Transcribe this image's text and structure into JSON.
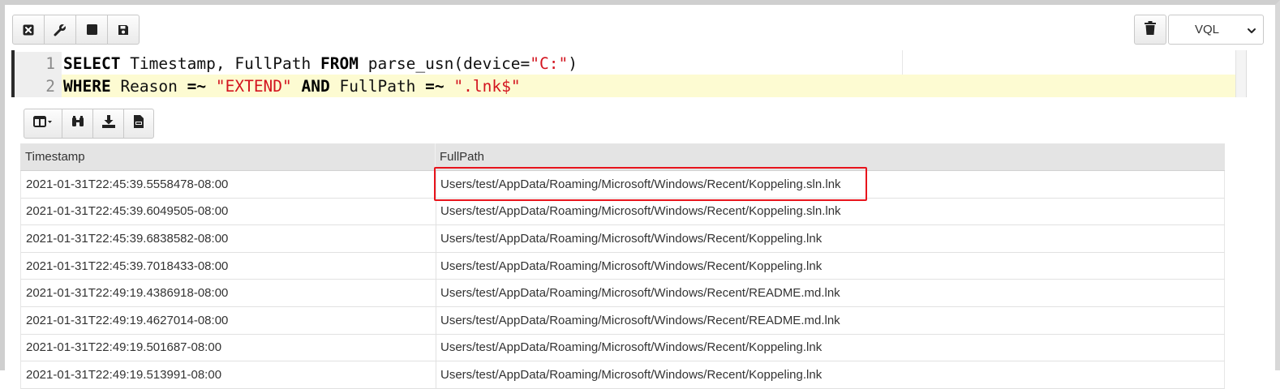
{
  "toolbar": {
    "buttons": [
      {
        "icon": "close-square-icon"
      },
      {
        "icon": "wrench-icon"
      },
      {
        "icon": "stop-icon"
      },
      {
        "icon": "save-icon"
      }
    ],
    "language_select": {
      "selected": "VQL"
    }
  },
  "editor": {
    "lines": [
      {
        "number": "1",
        "tokens": [
          {
            "t": "SELECT",
            "kind": "kw"
          },
          {
            "t": " Timestamp, FullPath ",
            "kind": "plain"
          },
          {
            "t": "FROM",
            "kind": "kw"
          },
          {
            "t": " parse_usn(device=",
            "kind": "plain"
          },
          {
            "t": "\"C:\"",
            "kind": "str"
          },
          {
            "t": ")",
            "kind": "plain"
          }
        ]
      },
      {
        "number": "2",
        "tokens": [
          {
            "t": "WHERE",
            "kind": "kw"
          },
          {
            "t": " Reason ",
            "kind": "plain"
          },
          {
            "t": "=~",
            "kind": "kw"
          },
          {
            "t": " ",
            "kind": "plain"
          },
          {
            "t": "\"EXTEND\"",
            "kind": "str"
          },
          {
            "t": " ",
            "kind": "plain"
          },
          {
            "t": "AND",
            "kind": "kw"
          },
          {
            "t": " FullPath ",
            "kind": "plain"
          },
          {
            "t": "=~",
            "kind": "kw"
          },
          {
            "t": " ",
            "kind": "plain"
          },
          {
            "t": "\".lnk$\"",
            "kind": "str"
          }
        ]
      }
    ]
  },
  "results_toolbar": {
    "buttons": [
      {
        "icon": "columns-icon"
      },
      {
        "icon": "binoculars-icon"
      },
      {
        "icon": "download-icon"
      },
      {
        "icon": "csv-file-icon"
      }
    ]
  },
  "table": {
    "columns": [
      "Timestamp",
      "FullPath"
    ],
    "rows": [
      [
        "2021-01-31T22:45:39.5558478-08:00",
        "Users/test/AppData/Roaming/Microsoft/Windows/Recent/Koppeling.sln.lnk"
      ],
      [
        "2021-01-31T22:45:39.6049505-08:00",
        "Users/test/AppData/Roaming/Microsoft/Windows/Recent/Koppeling.sln.lnk"
      ],
      [
        "2021-01-31T22:45:39.6838582-08:00",
        "Users/test/AppData/Roaming/Microsoft/Windows/Recent/Koppeling.lnk"
      ],
      [
        "2021-01-31T22:45:39.7018433-08:00",
        "Users/test/AppData/Roaming/Microsoft/Windows/Recent/Koppeling.lnk"
      ],
      [
        "2021-01-31T22:49:19.4386918-08:00",
        "Users/test/AppData/Roaming/Microsoft/Windows/Recent/README.md.lnk"
      ],
      [
        "2021-01-31T22:49:19.4627014-08:00",
        "Users/test/AppData/Roaming/Microsoft/Windows/Recent/README.md.lnk"
      ],
      [
        "2021-01-31T22:49:19.501687-08:00",
        "Users/test/AppData/Roaming/Microsoft/Windows/Recent/Koppeling.lnk"
      ],
      [
        "2021-01-31T22:49:19.513991-08:00",
        "Users/test/AppData/Roaming/Microsoft/Windows/Recent/Koppeling.lnk"
      ]
    ],
    "highlighted_row": 0,
    "highlight_color": "#e8141c"
  }
}
